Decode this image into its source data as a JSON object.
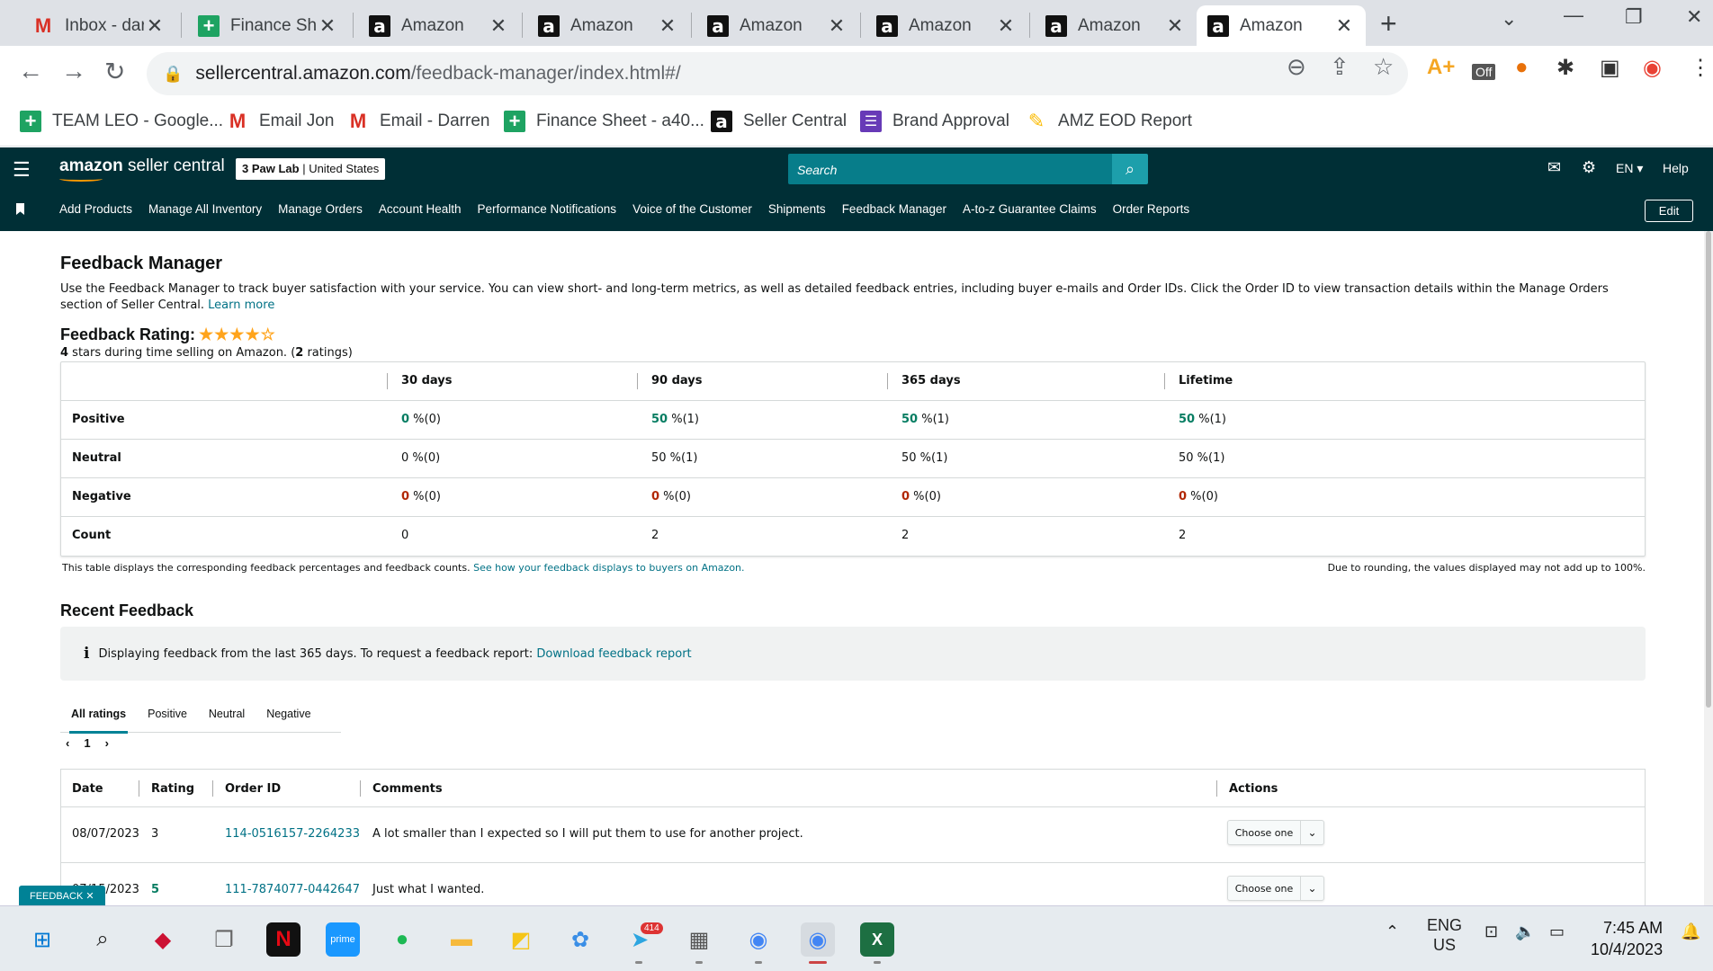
{
  "browser": {
    "tabs": [
      {
        "title": "Inbox - dar",
        "icon": "gmail-icon"
      },
      {
        "title": "Finance Sh",
        "icon": "sheets-icon"
      },
      {
        "title": "Amazon",
        "icon": "amazon-icon"
      },
      {
        "title": "Amazon",
        "icon": "amazon-icon"
      },
      {
        "title": "Amazon",
        "icon": "amazon-icon"
      },
      {
        "title": "Amazon",
        "icon": "amazon-icon"
      },
      {
        "title": "Amazon",
        "icon": "amazon-icon"
      },
      {
        "title": "Amazon",
        "icon": "amazon-icon"
      }
    ],
    "url_host": "sellercentral.amazon.com",
    "url_path": "/feedback-manager/index.html#/",
    "bookmarks": [
      {
        "label": "TEAM LEO - Google...",
        "icon": "sheets-icon"
      },
      {
        "label": "Email Jon",
        "icon": "gmail-icon"
      },
      {
        "label": "Email - Darren",
        "icon": "gmail-icon"
      },
      {
        "label": "Finance Sheet - a40...",
        "icon": "sheets-icon"
      },
      {
        "label": "Seller Central",
        "icon": "amazon-icon"
      },
      {
        "label": "Brand Approval",
        "icon": "forms-icon"
      },
      {
        "label": "AMZ EOD Report",
        "icon": "eod-icon"
      }
    ]
  },
  "seller_central": {
    "logo_text_bold": "amazon",
    "logo_text": " seller central",
    "store_name": "3 Paw Lab",
    "store_region": "United States",
    "search_placeholder": "Search",
    "language": "EN",
    "help": "Help",
    "nav": [
      "Add Products",
      "Manage All Inventory",
      "Manage Orders",
      "Account Health",
      "Performance Notifications",
      "Voice of the Customer",
      "Shipments",
      "Feedback Manager",
      "A-to-z Guarantee Claims",
      "Order Reports"
    ],
    "edit": "Edit"
  },
  "page": {
    "title": "Feedback Manager",
    "description": "Use the Feedback Manager to track buyer satisfaction with your service. You can view short- and long-term metrics, as well as detailed feedback entries, including buyer e-mails and Order IDs. Click the Order ID to view transaction details within the Manage Orders section of Seller Central.",
    "learn_more": "Learn more",
    "rating_title": "Feedback Rating:",
    "stars": "★★★★☆",
    "rating_stars_num": "4",
    "rating_sub_a": " stars during time selling on Amazon. (",
    "rating_count": "2",
    "rating_sub_b": " ratings)",
    "summary": {
      "headers": [
        "30 days",
        "90 days",
        "365 days",
        "Lifetime"
      ],
      "rows": [
        {
          "label": "Positive",
          "values": [
            [
              "0",
              " %(0)"
            ],
            [
              "50",
              " %(1)"
            ],
            [
              "50",
              " %(1)"
            ],
            [
              "50",
              " %(1)"
            ]
          ]
        },
        {
          "label": "Neutral",
          "values": [
            [
              "0",
              " %(0)"
            ],
            [
              "50",
              " %(1)"
            ],
            [
              "50",
              " %(1)"
            ],
            [
              "50",
              " %(1)"
            ]
          ]
        },
        {
          "label": "Negative",
          "values": [
            [
              "0",
              " %(0)"
            ],
            [
              "0",
              " %(0)"
            ],
            [
              "0",
              " %(0)"
            ],
            [
              "0",
              " %(0)"
            ]
          ]
        },
        {
          "label": "Count",
          "values": [
            [
              "0",
              ""
            ],
            [
              "2",
              ""
            ],
            [
              "2",
              ""
            ],
            [
              "2",
              ""
            ]
          ]
        }
      ]
    },
    "table_note": "This table displays the corresponding feedback percentages and feedback counts.",
    "table_note_link": "See how your feedback displays to buyers on Amazon.",
    "rounding_note": "Due to rounding, the values displayed may not add up to 100%.",
    "recent_title": "Recent Feedback",
    "alert_text": "Displaying feedback from the last 365 days. To request a feedback report:",
    "alert_link": "Download feedback report",
    "tabs": [
      "All ratings",
      "Positive",
      "Neutral",
      "Negative"
    ],
    "page_num": "1",
    "feedback_headers": [
      "Date",
      "Rating",
      "Order ID",
      "Comments",
      "Actions"
    ],
    "feedback_rows": [
      {
        "date": "08/07/2023",
        "rating": "3",
        "order": "114-0516157-2264233",
        "comment": "A lot smaller than I expected so I will put them to use for another project.",
        "action": "Choose one"
      },
      {
        "date": "07/15/2023",
        "rating": "5",
        "order": "111-7874077-0442647",
        "comment": "Just what I wanted.",
        "action": "Choose one"
      }
    ],
    "feedback_badge": "FEEDBACK ✕"
  },
  "taskbar": {
    "lang_top": "ENG",
    "lang_bottom": "US",
    "time": "7:45 AM",
    "date": "10/4/2023",
    "telegram_badge": "414"
  },
  "colors": {
    "header_bg": "#002f36",
    "positive": "#067d62",
    "negative": "#b12704",
    "link": "#007185"
  }
}
